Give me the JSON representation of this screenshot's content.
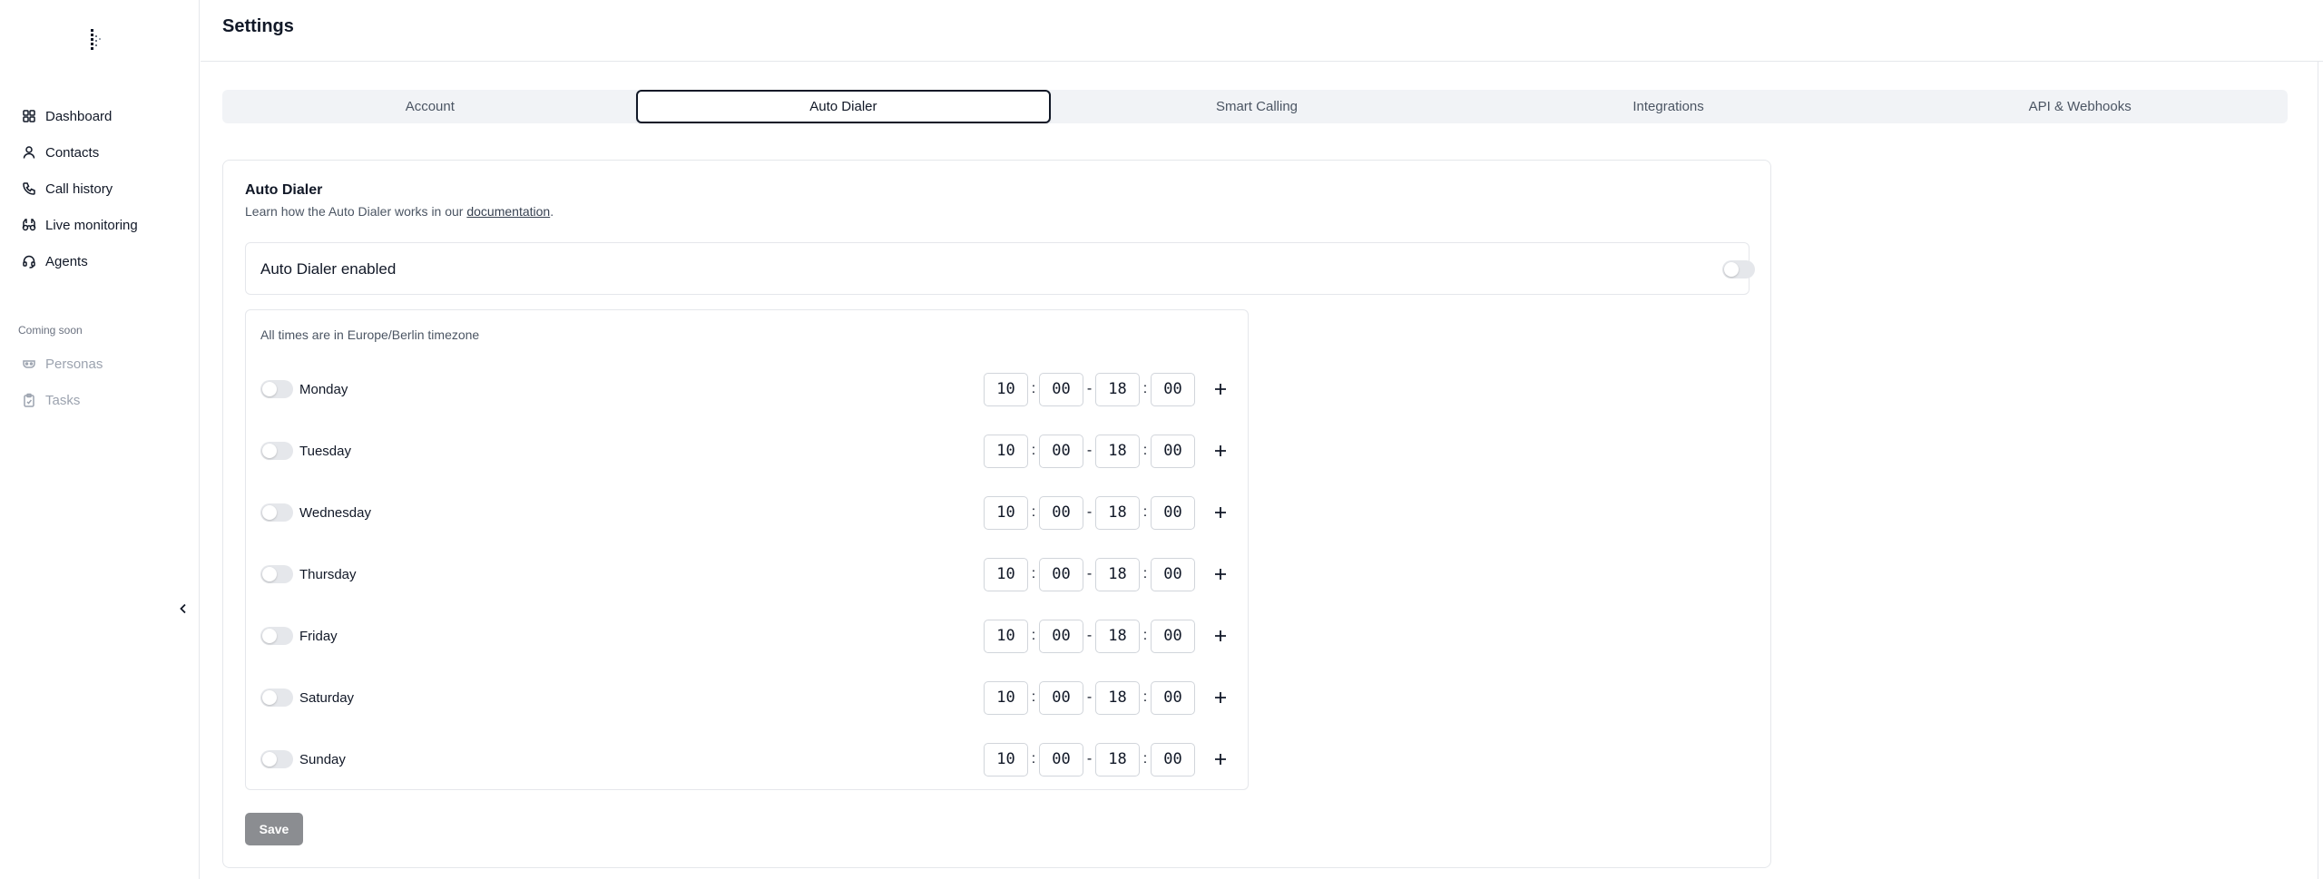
{
  "sidebar": {
    "items": [
      {
        "label": "Dashboard",
        "icon": "dashboard-icon"
      },
      {
        "label": "Contacts",
        "icon": "user-icon"
      },
      {
        "label": "Call history",
        "icon": "phone-icon"
      },
      {
        "label": "Live monitoring",
        "icon": "binoculars-icon"
      },
      {
        "label": "Agents",
        "icon": "headset-icon"
      }
    ],
    "coming_soon_label": "Coming soon",
    "coming_soon_items": [
      {
        "label": "Personas",
        "icon": "mask-icon"
      },
      {
        "label": "Tasks",
        "icon": "clipboard-icon"
      }
    ]
  },
  "header": {
    "title": "Settings"
  },
  "tabs": [
    {
      "label": "Account"
    },
    {
      "label": "Auto Dialer",
      "active": true
    },
    {
      "label": "Smart Calling"
    },
    {
      "label": "Integrations"
    },
    {
      "label": "API & Webhooks"
    }
  ],
  "auto_dialer": {
    "title": "Auto Dialer",
    "desc_prefix": "Learn how the Auto Dialer works in our ",
    "desc_link": "documentation",
    "desc_suffix": ".",
    "enabled_label": "Auto Dialer enabled",
    "enabled": false,
    "timezone_note": "All times are in Europe/Berlin timezone",
    "days": [
      {
        "name": "Monday",
        "enabled": false,
        "start_h": "10",
        "start_m": "00",
        "end_h": "18",
        "end_m": "00"
      },
      {
        "name": "Tuesday",
        "enabled": false,
        "start_h": "10",
        "start_m": "00",
        "end_h": "18",
        "end_m": "00"
      },
      {
        "name": "Wednesday",
        "enabled": false,
        "start_h": "10",
        "start_m": "00",
        "end_h": "18",
        "end_m": "00"
      },
      {
        "name": "Thursday",
        "enabled": false,
        "start_h": "10",
        "start_m": "00",
        "end_h": "18",
        "end_m": "00"
      },
      {
        "name": "Friday",
        "enabled": false,
        "start_h": "10",
        "start_m": "00",
        "end_h": "18",
        "end_m": "00"
      },
      {
        "name": "Saturday",
        "enabled": false,
        "start_h": "10",
        "start_m": "00",
        "end_h": "18",
        "end_m": "00"
      },
      {
        "name": "Sunday",
        "enabled": false,
        "start_h": "10",
        "start_m": "00",
        "end_h": "18",
        "end_m": "00"
      }
    ],
    "time_separator": ":",
    "range_separator": "-",
    "save_label": "Save"
  },
  "colors": {
    "accent": "#111827",
    "muted": "#6b7280",
    "border": "#e5e7eb",
    "save_bg": "#8b8d91"
  }
}
